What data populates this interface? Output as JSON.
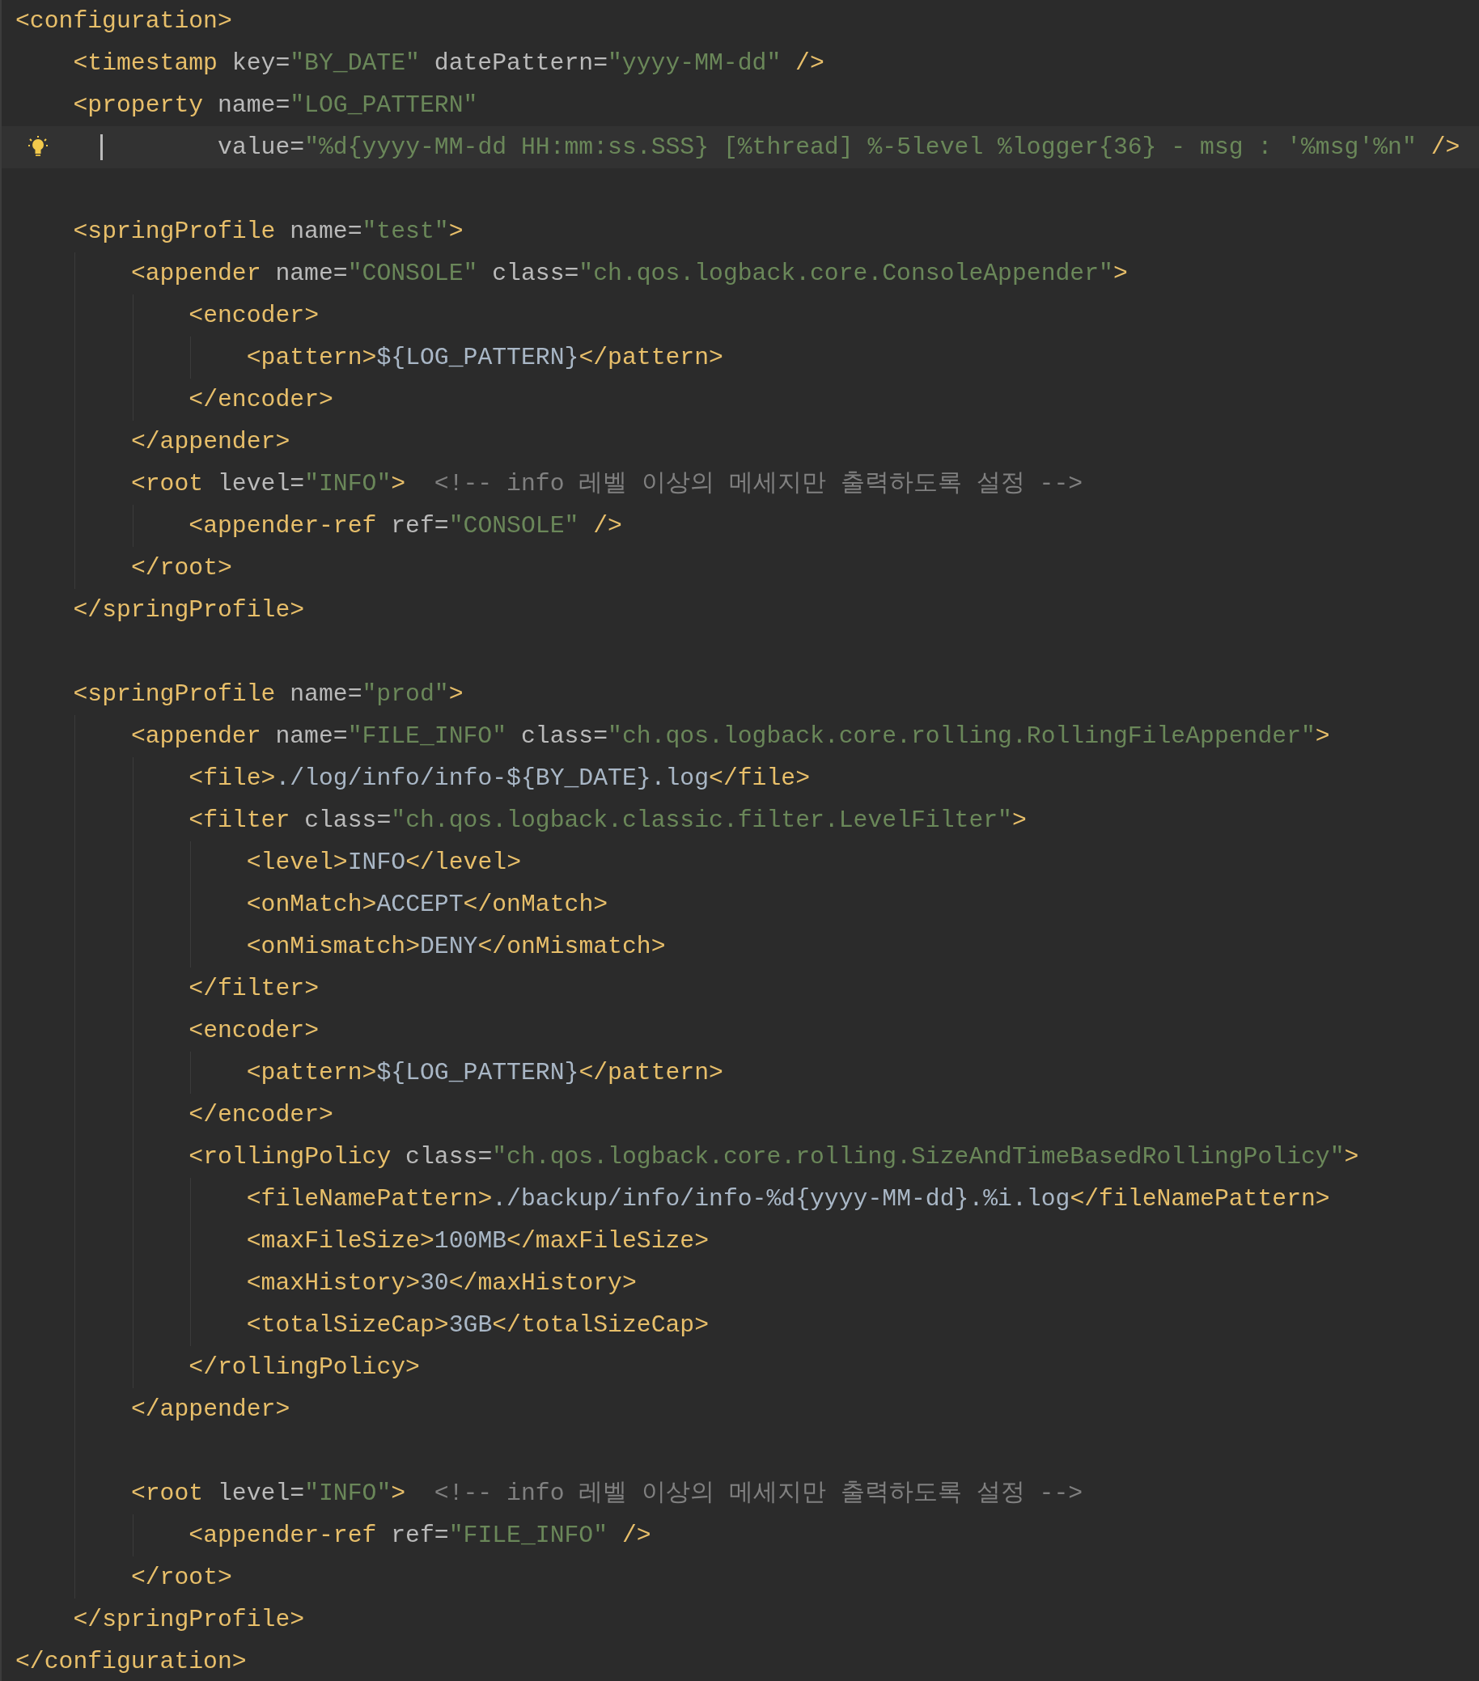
{
  "editor": {
    "lines": [
      {
        "kind": "code",
        "tokens": [
          {
            "kind": "tag",
            "text": "<configuration>"
          }
        ],
        "children": [
          {
            "kind": "code",
            "tokens": [
              {
                "kind": "tag",
                "text": "<timestamp"
              },
              {
                "kind": "attr",
                "text": " key="
              },
              {
                "kind": "string",
                "text": "\"BY_DATE\""
              },
              {
                "kind": "attr",
                "text": " datePattern="
              },
              {
                "kind": "string",
                "text": "\"yyyy-MM-dd\""
              },
              {
                "kind": "tag",
                "text": " />"
              }
            ]
          },
          {
            "kind": "code",
            "tokens": [
              {
                "kind": "tag",
                "text": "<property"
              },
              {
                "kind": "attr",
                "text": " name="
              },
              {
                "kind": "string",
                "text": "\"LOG_PATTERN\""
              }
            ],
            "children": [
              {
                "kind": "continuation",
                "current": true,
                "tokens": [
                  {
                    "kind": "attr",
                    "text": "value="
                  },
                  {
                    "kind": "string",
                    "text": "\"%d{yyyy-MM-dd HH:mm:ss.SSS} [%thread] %-5level %logger{36} - msg : '%msg'%n\""
                  },
                  {
                    "kind": "tag",
                    "text": " />"
                  }
                ]
              }
            ]
          },
          {
            "kind": "blank"
          },
          {
            "kind": "code",
            "tokens": [
              {
                "kind": "tag",
                "text": "<springProfile"
              },
              {
                "kind": "attr",
                "text": " name="
              },
              {
                "kind": "string",
                "text": "\"test\""
              },
              {
                "kind": "tag",
                "text": ">"
              }
            ],
            "children": [
              {
                "kind": "code",
                "tokens": [
                  {
                    "kind": "tag",
                    "text": "<appender"
                  },
                  {
                    "kind": "attr",
                    "text": " name="
                  },
                  {
                    "kind": "string",
                    "text": "\"CONSOLE\""
                  },
                  {
                    "kind": "attr",
                    "text": " class="
                  },
                  {
                    "kind": "string",
                    "text": "\"ch.qos.logback.core.ConsoleAppender\""
                  },
                  {
                    "kind": "tag",
                    "text": ">"
                  }
                ],
                "children": [
                  {
                    "kind": "code",
                    "tokens": [
                      {
                        "kind": "tag",
                        "text": "<encoder>"
                      }
                    ],
                    "children": [
                      {
                        "kind": "code",
                        "tokens": [
                          {
                            "kind": "tag",
                            "text": "<pattern>"
                          },
                          {
                            "kind": "text",
                            "text": "${LOG_PATTERN}"
                          },
                          {
                            "kind": "tag",
                            "text": "</pattern>"
                          }
                        ]
                      }
                    ]
                  },
                  {
                    "kind": "code",
                    "tokens": [
                      {
                        "kind": "tag",
                        "text": "</encoder>"
                      }
                    ]
                  }
                ]
              },
              {
                "kind": "code",
                "tokens": [
                  {
                    "kind": "tag",
                    "text": "</appender>"
                  }
                ]
              },
              {
                "kind": "code",
                "tokens": [
                  {
                    "kind": "tag",
                    "text": "<root"
                  },
                  {
                    "kind": "attr",
                    "text": " level="
                  },
                  {
                    "kind": "string",
                    "text": "\"INFO\""
                  },
                  {
                    "kind": "tag",
                    "text": ">"
                  },
                  {
                    "kind": "comment",
                    "text": "  <!-- info 레벨 이상의 메세지만 출력하도록 설정 -->"
                  }
                ],
                "children": [
                  {
                    "kind": "code",
                    "tokens": [
                      {
                        "kind": "tag",
                        "text": "<appender-ref"
                      },
                      {
                        "kind": "attr",
                        "text": " ref="
                      },
                      {
                        "kind": "string",
                        "text": "\"CONSOLE\""
                      },
                      {
                        "kind": "tag",
                        "text": " />"
                      }
                    ]
                  }
                ]
              },
              {
                "kind": "code",
                "tokens": [
                  {
                    "kind": "tag",
                    "text": "</root>"
                  }
                ]
              }
            ]
          },
          {
            "kind": "code",
            "tokens": [
              {
                "kind": "tag",
                "text": "</springProfile>"
              }
            ]
          },
          {
            "kind": "blank"
          },
          {
            "kind": "code",
            "tokens": [
              {
                "kind": "tag",
                "text": "<springProfile"
              },
              {
                "kind": "attr",
                "text": " name="
              },
              {
                "kind": "string",
                "text": "\"prod\""
              },
              {
                "kind": "tag",
                "text": ">"
              }
            ],
            "children": [
              {
                "kind": "code",
                "tokens": [
                  {
                    "kind": "tag",
                    "text": "<appender"
                  },
                  {
                    "kind": "attr",
                    "text": " name="
                  },
                  {
                    "kind": "string",
                    "text": "\"FILE_INFO\""
                  },
                  {
                    "kind": "attr",
                    "text": " class="
                  },
                  {
                    "kind": "string",
                    "text": "\"ch.qos.logback.core.rolling.RollingFileAppender\""
                  },
                  {
                    "kind": "tag",
                    "text": ">"
                  }
                ],
                "children": [
                  {
                    "kind": "code",
                    "tokens": [
                      {
                        "kind": "tag",
                        "text": "<file>"
                      },
                      {
                        "kind": "text",
                        "text": "./log/info/info-${BY_DATE}.log"
                      },
                      {
                        "kind": "tag",
                        "text": "</file>"
                      }
                    ]
                  },
                  {
                    "kind": "code",
                    "tokens": [
                      {
                        "kind": "tag",
                        "text": "<filter"
                      },
                      {
                        "kind": "attr",
                        "text": " class="
                      },
                      {
                        "kind": "string",
                        "text": "\"ch.qos.logback.classic.filter.LevelFilter\""
                      },
                      {
                        "kind": "tag",
                        "text": ">"
                      }
                    ],
                    "children": [
                      {
                        "kind": "code",
                        "tokens": [
                          {
                            "kind": "tag",
                            "text": "<level>"
                          },
                          {
                            "kind": "text",
                            "text": "INFO"
                          },
                          {
                            "kind": "tag",
                            "text": "</level>"
                          }
                        ]
                      },
                      {
                        "kind": "code",
                        "tokens": [
                          {
                            "kind": "tag",
                            "text": "<onMatch>"
                          },
                          {
                            "kind": "text",
                            "text": "ACCEPT"
                          },
                          {
                            "kind": "tag",
                            "text": "</onMatch>"
                          }
                        ]
                      },
                      {
                        "kind": "code",
                        "tokens": [
                          {
                            "kind": "tag",
                            "text": "<onMismatch>"
                          },
                          {
                            "kind": "text",
                            "text": "DENY"
                          },
                          {
                            "kind": "tag",
                            "text": "</onMismatch>"
                          }
                        ]
                      }
                    ]
                  },
                  {
                    "kind": "code",
                    "tokens": [
                      {
                        "kind": "tag",
                        "text": "</filter>"
                      }
                    ]
                  },
                  {
                    "kind": "code",
                    "tokens": [
                      {
                        "kind": "tag",
                        "text": "<encoder>"
                      }
                    ],
                    "children": [
                      {
                        "kind": "code",
                        "tokens": [
                          {
                            "kind": "tag",
                            "text": "<pattern>"
                          },
                          {
                            "kind": "text",
                            "text": "${LOG_PATTERN}"
                          },
                          {
                            "kind": "tag",
                            "text": "</pattern>"
                          }
                        ]
                      }
                    ]
                  },
                  {
                    "kind": "code",
                    "tokens": [
                      {
                        "kind": "tag",
                        "text": "</encoder>"
                      }
                    ]
                  },
                  {
                    "kind": "code",
                    "tokens": [
                      {
                        "kind": "tag",
                        "text": "<rollingPolicy"
                      },
                      {
                        "kind": "attr",
                        "text": " class="
                      },
                      {
                        "kind": "string",
                        "text": "\"ch.qos.logback.core.rolling.SizeAndTimeBasedRollingPolicy\""
                      },
                      {
                        "kind": "tag",
                        "text": ">"
                      }
                    ],
                    "children": [
                      {
                        "kind": "code",
                        "tokens": [
                          {
                            "kind": "tag",
                            "text": "<fileNamePattern>"
                          },
                          {
                            "kind": "text",
                            "text": "./backup/info/info-%d{yyyy-MM-dd}.%i.log"
                          },
                          {
                            "kind": "tag",
                            "text": "</fileNamePattern>"
                          }
                        ]
                      },
                      {
                        "kind": "code",
                        "tokens": [
                          {
                            "kind": "tag",
                            "text": "<maxFileSize>"
                          },
                          {
                            "kind": "text",
                            "text": "100MB"
                          },
                          {
                            "kind": "tag",
                            "text": "</maxFileSize>"
                          }
                        ]
                      },
                      {
                        "kind": "code",
                        "tokens": [
                          {
                            "kind": "tag",
                            "text": "<maxHistory>"
                          },
                          {
                            "kind": "text",
                            "text": "30"
                          },
                          {
                            "kind": "tag",
                            "text": "</maxHistory>"
                          }
                        ]
                      },
                      {
                        "kind": "code",
                        "tokens": [
                          {
                            "kind": "tag",
                            "text": "<totalSizeCap>"
                          },
                          {
                            "kind": "text",
                            "text": "3GB"
                          },
                          {
                            "kind": "tag",
                            "text": "</totalSizeCap>"
                          }
                        ]
                      }
                    ]
                  },
                  {
                    "kind": "code",
                    "tokens": [
                      {
                        "kind": "tag",
                        "text": "</rollingPolicy>"
                      }
                    ]
                  }
                ]
              },
              {
                "kind": "code",
                "tokens": [
                  {
                    "kind": "tag",
                    "text": "</appender>"
                  }
                ]
              },
              {
                "kind": "blank"
              },
              {
                "kind": "code",
                "tokens": [
                  {
                    "kind": "tag",
                    "text": "<root"
                  },
                  {
                    "kind": "attr",
                    "text": " level="
                  },
                  {
                    "kind": "string",
                    "text": "\"INFO\""
                  },
                  {
                    "kind": "tag",
                    "text": ">"
                  },
                  {
                    "kind": "comment",
                    "text": "  <!-- info 레벨 이상의 메세지만 출력하도록 설정 -->"
                  }
                ],
                "children": [
                  {
                    "kind": "code",
                    "tokens": [
                      {
                        "kind": "tag",
                        "text": "<appender-ref"
                      },
                      {
                        "kind": "attr",
                        "text": " ref="
                      },
                      {
                        "kind": "string",
                        "text": "\"FILE_INFO\""
                      },
                      {
                        "kind": "tag",
                        "text": " />"
                      }
                    ]
                  }
                ]
              },
              {
                "kind": "code",
                "tokens": [
                  {
                    "kind": "tag",
                    "text": "</root>"
                  }
                ]
              }
            ]
          },
          {
            "kind": "code",
            "tokens": [
              {
                "kind": "tag",
                "text": "</springProfile>"
              }
            ]
          }
        ]
      },
      {
        "kind": "code",
        "tokens": [
          {
            "kind": "tag",
            "text": "</configuration>"
          }
        ]
      }
    ]
  }
}
